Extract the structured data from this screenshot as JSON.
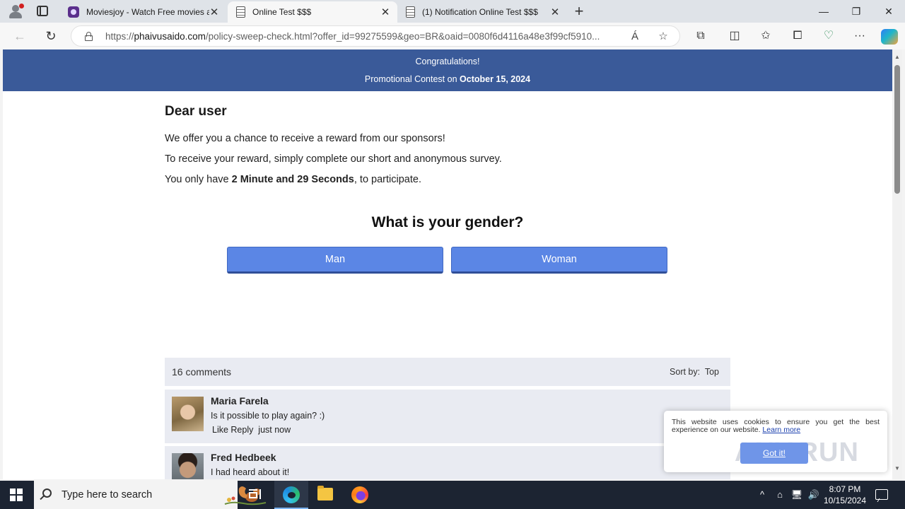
{
  "browser": {
    "tabs": [
      {
        "title": "Moviesjoy - Watch Free movies a",
        "close": "✕"
      },
      {
        "title": "Online Test $$$",
        "close": "✕"
      },
      {
        "title": "(1) Notification Online Test $$$",
        "close": "✕"
      }
    ],
    "new_tab": "+",
    "window": {
      "minimize": "—",
      "maximize": "❐",
      "close": "✕"
    },
    "nav": {
      "back": "←",
      "reload": "↻"
    },
    "url": {
      "scheme": "https://",
      "host": "phaivusaido.com",
      "path": "/policy-sweep-check.html?offer_id=99275599&geo=BR&oaid=0080f6d4116a48e3f99cf5910..."
    },
    "toolbar_icons": {
      "read_aloud": "Á",
      "favorite": "☆",
      "extensions": "⧉",
      "split": "◫",
      "favorites": "✩",
      "collections": "⧠",
      "performance": "♡",
      "more": "···"
    }
  },
  "banner": {
    "line1": "Congratulations!",
    "line2_prefix": "Promotional Contest on ",
    "date": "October 15, 2024"
  },
  "page": {
    "greeting": "Dear user",
    "p1": "We offer you a chance to receive a reward from our sponsors!",
    "p2": "To receive your reward, simply complete our short and anonymous survey.",
    "p3_prefix": "You only have ",
    "p3_time": "2 Minute and 29 Seconds",
    "p3_suffix": ", to participate.",
    "question": "What is your gender?",
    "answers": [
      "Man",
      "Woman"
    ]
  },
  "comments": {
    "count_label": "16 comments",
    "sort_label": "Sort by:",
    "sort_value": "Top",
    "items": [
      {
        "name": "Maria Farela",
        "text": "Is it possible to play again? :)",
        "meta": "Like Reply  just now"
      },
      {
        "name": "Fred Hedbeek",
        "text": "I had heard about it!"
      }
    ]
  },
  "cookie": {
    "text": "This website uses cookies to ensure you get the best experience on our website.",
    "link": "Learn more",
    "button": "Got it!",
    "watermark": "ANY.RUN"
  },
  "taskbar": {
    "search_placeholder": "Type here to search",
    "time": "8:07 PM",
    "date": "10/15/2024",
    "tray": {
      "chevron": "^",
      "volume": "🔊"
    }
  }
}
